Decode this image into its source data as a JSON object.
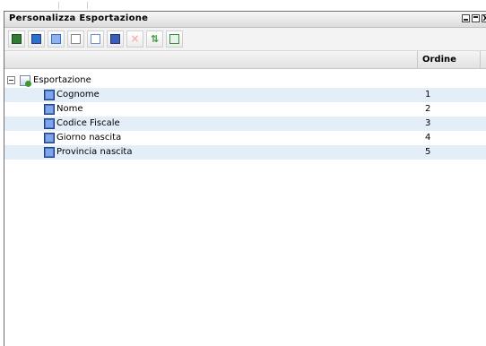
{
  "window": {
    "title": "Personalizza Esportazione",
    "controls": {
      "minimize_icon": "minimize-icon",
      "maximize_icon": "maximize-icon",
      "close_glyph": "X"
    }
  },
  "toolbar": {
    "buttons": [
      {
        "name": "exit-button",
        "icon": "exit-icon",
        "color": "#2e7d32"
      },
      {
        "name": "save-button",
        "icon": "save-icon",
        "color": "#2f6fcf"
      },
      {
        "name": "save-as-button",
        "icon": "copy-icon",
        "color": "#2f6fcf"
      },
      {
        "name": "new-button",
        "icon": "new-document-icon",
        "color": "#43a047"
      },
      {
        "name": "preview-button",
        "icon": "preview-icon",
        "color": "#6b8fd6"
      },
      {
        "name": "add-field-button",
        "icon": "field-icon",
        "color": "#3b5fb8"
      },
      {
        "name": "delete-button",
        "icon": "delete-icon",
        "color": "#f1b3b3",
        "disabled": true
      },
      {
        "name": "sort-button",
        "icon": "sort-icon",
        "color": "#3e9b3e"
      },
      {
        "name": "export-button",
        "icon": "export-icon",
        "color": "#2f8f3f"
      }
    ]
  },
  "grid": {
    "columns": [
      "",
      "Ordine"
    ],
    "root": {
      "label": "Esportazione",
      "expanded": true
    },
    "rows": [
      {
        "label": "Cognome",
        "order": "1"
      },
      {
        "label": "Nome",
        "order": "2"
      },
      {
        "label": "Codice Fiscale",
        "order": "3"
      },
      {
        "label": "Giorno nascita",
        "order": "4"
      },
      {
        "label": "Provincia nascita",
        "order": "5"
      }
    ]
  },
  "colors": {
    "row_alt": "#e3eef9",
    "toolbar_bg": "#f3f3f3"
  }
}
